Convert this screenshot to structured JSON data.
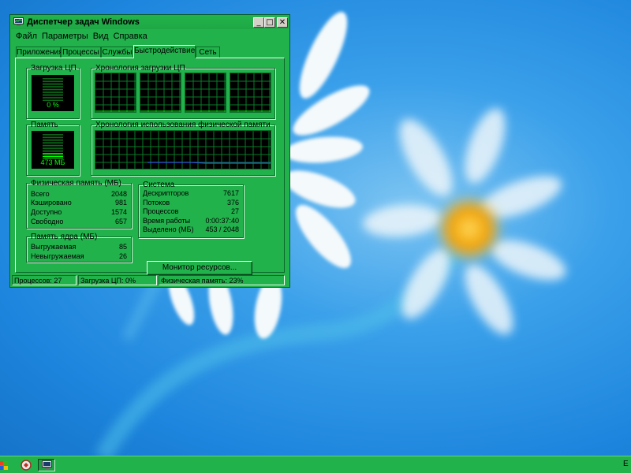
{
  "window": {
    "title": "Диспетчер задач Windows",
    "controls": {
      "minimize": "_",
      "maximize": "□",
      "close": "✕"
    }
  },
  "menu": [
    "Файл",
    "Параметры",
    "Вид",
    "Справка"
  ],
  "tabs": [
    "Приложения",
    "Процессы",
    "Службы",
    "Быстродействие",
    "Сеть"
  ],
  "active_tab": "Быстродействие",
  "cpu": {
    "title": "Загрузка ЦП",
    "value": "0 %",
    "level": 0.0
  },
  "cpu_history": {
    "title": "Хронология загрузки ЦП",
    "cores": 4
  },
  "memory": {
    "title": "Память",
    "value": "473 МБ",
    "level": 0.23
  },
  "memory_history": {
    "title": "Хронология использования физической памяти",
    "level": 0.23
  },
  "physical_memory": {
    "title": "Физическая память (МБ)",
    "rows": [
      {
        "k": "Всего",
        "v": "2048"
      },
      {
        "k": "Кэшировано",
        "v": "981"
      },
      {
        "k": "Доступно",
        "v": "1574"
      },
      {
        "k": "Свободно",
        "v": "657"
      }
    ]
  },
  "kernel_memory": {
    "title": "Память ядра (МБ)",
    "rows": [
      {
        "k": "Выгружаемая",
        "v": "85"
      },
      {
        "k": "Невыгружаемая",
        "v": "26"
      }
    ]
  },
  "system": {
    "title": "Система",
    "rows": [
      {
        "k": "Дескрипторов",
        "v": "7617"
      },
      {
        "k": "Потоков",
        "v": "376"
      },
      {
        "k": "Процессов",
        "v": "27"
      },
      {
        "k": "Время работы",
        "v": "0:00:37:40"
      },
      {
        "k": "Выделено (МБ)",
        "v": "453 / 2048"
      }
    ]
  },
  "resource_monitor_button": "Монитор ресурсов...",
  "statusbar": {
    "processes": "Процессов: 27",
    "cpu": "Загрузка ЦП: 0%",
    "memory": "Физическая память: 23%"
  },
  "taskbar": {
    "tray_text": "E"
  },
  "colors": {
    "window_green": "#22b24c",
    "graph_green": "#00ff00",
    "grid_green": "#0a7a28",
    "memory_line": "#2f5be0",
    "desktop_blue": "#1d85dd"
  }
}
